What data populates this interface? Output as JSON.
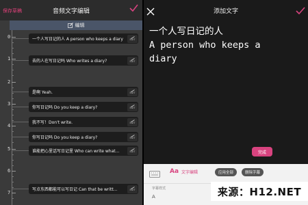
{
  "left_panel": {
    "back_label": "保存草稿",
    "title": "音频文字编辑",
    "edit_bar_label": "编辑",
    "timeline_ticks": [
      "0",
      "1",
      "2",
      "3",
      "4",
      "5",
      "6",
      "7"
    ],
    "captions": [
      {
        "text": "一个人写日记的人 A person who keeps a diary",
        "button": "EDIT"
      },
      {
        "text": "去的人在写日记吗 Who writes a diary?",
        "button": "EDIT"
      },
      {
        "text": "是啊 Yeah.",
        "button": "EDIT"
      },
      {
        "text": "你写日记吗 Do you keep a diary?",
        "button": "EDIT"
      },
      {
        "text": "我不写！Don't write.",
        "button": "EDIT"
      },
      {
        "text": "你写日记吗 Do you keep a diary?",
        "button": "EDIT"
      },
      {
        "text": "谁能把心里话写日记里 Who can write what...",
        "button": "EDIT"
      },
      {
        "text": "写点东西都能可以写日记 Can that be writt...",
        "button": "EDIT"
      }
    ]
  },
  "right_panel": {
    "title": "添加文字",
    "text_lines": [
      "一个人写日记的人",
      "A person who keeps a",
      "diary"
    ],
    "confirm_label": "完成",
    "bottom_bar": {
      "tool_icon_text": "Aa",
      "tool_label": "文字编辑",
      "pill_1": "应用全部",
      "pill_2": "删除字幕",
      "small_label": "字幕样式",
      "a_label": "A"
    }
  },
  "watermark": "来源：H12.NET",
  "colors": {
    "accent": "#d8437f",
    "left_bg": "#3a3a3a",
    "caption_bg": "#1d1d1d",
    "right_bg": "#1a1a1a",
    "edit_bar": "#4a5568"
  }
}
